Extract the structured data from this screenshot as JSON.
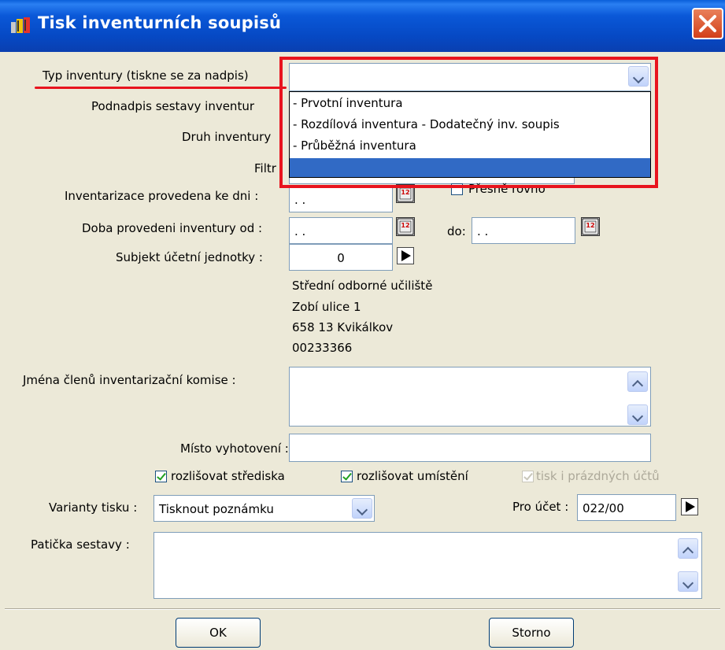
{
  "window": {
    "title": "Tisk inventurních soupisů"
  },
  "labels": {
    "typ": "Typ inventury (tiskne se za nadpis)",
    "podnadpis": "Podnadpis sestavy inventur",
    "druh": "Druh inventury",
    "filtr": "Filtr",
    "ke_dni": "Inventarizace provedena ke dni :",
    "doba": "Doba provedeni inventury od :",
    "do": "do:",
    "subjekt": "Subjekt účetní jednotky :",
    "komise": "Jména členů inventarizační komise :",
    "misto": "Místo vyhotovení :",
    "varianty": "Varianty tisku :",
    "pro_ucet": "Pro účet :",
    "paticka": "Patička sestavy :"
  },
  "fields": {
    "ke_dni": ". .",
    "doba_od": ". .",
    "doba_do": ". .",
    "subjekt": "0",
    "varianty": "Tisknout poznámku",
    "pro_ucet": "022/00"
  },
  "address": {
    "line1": "Střední odborné učiliště",
    "line2": "Zobí ulice 1",
    "line3": "658 13 Kvikálkov",
    "line4": "00233366"
  },
  "dropdown": {
    "options": [
      "- Prvotní inventura",
      "- Rozdílová inventura - Dodatečný inv. soupis",
      "- Průběžná inventura"
    ]
  },
  "checkboxes": {
    "presne": "Přesně rovno",
    "strediska": "rozlišovat střediska",
    "umisteni": "rozlišovat umístění",
    "prazdnych": "tisk i prázdných účtů"
  },
  "buttons": {
    "ok": "OK",
    "storno": "Storno"
  },
  "calendar_icon_text": "12"
}
